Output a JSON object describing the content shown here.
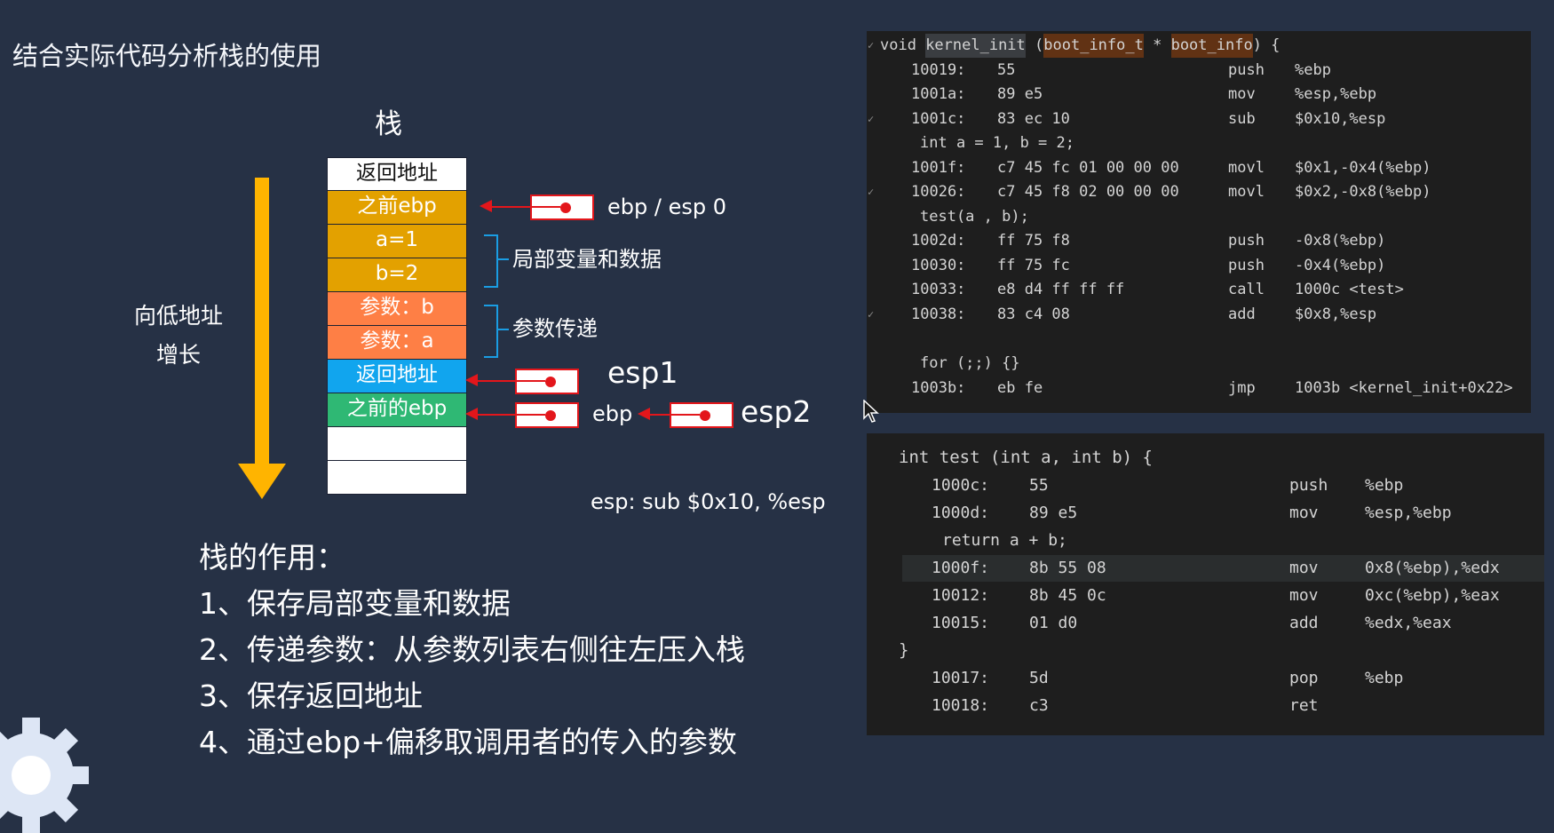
{
  "title": "结合实际代码分析栈的使用",
  "stack": {
    "heading": "栈",
    "cells": [
      {
        "text": "返回地址",
        "color": "#ffffff"
      },
      {
        "text": "之前ebp",
        "color": "#e3a100"
      },
      {
        "text": "a=1",
        "color": "#e3a100"
      },
      {
        "text": "b=2",
        "color": "#e3a100"
      },
      {
        "text": "参数：b",
        "color": "#fe7f45"
      },
      {
        "text": "参数：a",
        "color": "#fe7f45"
      },
      {
        "text": "返回地址",
        "color": "#11a5ee"
      },
      {
        "text": "之前的ebp",
        "color": "#2fb874"
      },
      {
        "text": "",
        "color": "#ffffff"
      },
      {
        "text": "",
        "color": "#ffffff"
      }
    ]
  },
  "direction_label": {
    "line1": "向低地址",
    "line2": "增长"
  },
  "annotations": {
    "ebp_esp0": "ebp / esp 0",
    "locals": "局部变量和数据",
    "params": "参数传递",
    "esp1": "esp1",
    "ebp": "ebp",
    "esp2": "esp2",
    "sub_note": "esp: sub $0x10, %esp"
  },
  "usage": {
    "heading": "栈的作用：",
    "items": [
      "1、保存局部变量和数据",
      "2、传递参数：从参数列表右侧往左压入栈",
      "3、保存返回地址",
      "4、通过ebp+偏移取调用者的传入的参数"
    ]
  },
  "code_top": {
    "header": {
      "prefix": "void ",
      "name": "kernel_init",
      "mid": " (",
      "type": "boot_info_t",
      "star": " * ",
      "param": "boot_info",
      "suffix": ") {"
    },
    "lines": [
      {
        "addr": "10019:",
        "bytes": "55",
        "op": "push",
        "args": "%ebp"
      },
      {
        "addr": "1001a:",
        "bytes": "89 e5",
        "op": "mov",
        "args": "%esp,%ebp"
      },
      {
        "addr": "1001c:",
        "bytes": "83 ec 10",
        "op": "sub",
        "args": "$0x10,%esp"
      },
      {
        "src": "int a = 1, b = 2;"
      },
      {
        "addr": "1001f:",
        "bytes": "c7 45 fc 01 00 00 00",
        "op": "movl",
        "args": "$0x1,-0x4(%ebp)"
      },
      {
        "addr": "10026:",
        "bytes": "c7 45 f8 02 00 00 00",
        "op": "movl",
        "args": "$0x2,-0x8(%ebp)"
      },
      {
        "src": "test(a , b);"
      },
      {
        "addr": "1002d:",
        "bytes": "ff 75 f8",
        "op": "push",
        "args": "-0x8(%ebp)"
      },
      {
        "addr": "10030:",
        "bytes": "ff 75 fc",
        "op": "push",
        "args": "-0x4(%ebp)"
      },
      {
        "addr": "10033:",
        "bytes": "e8 d4 ff ff ff",
        "op": "call",
        "args": "1000c <test>"
      },
      {
        "addr": "10038:",
        "bytes": "83 c4 08",
        "op": "add",
        "args": "$0x8,%esp"
      },
      {
        "blank": ""
      },
      {
        "src": "for (;;) {}"
      },
      {
        "addr": "1003b:",
        "bytes": "eb fe",
        "op": "jmp",
        "args": "1003b <kernel_init+0x22>"
      }
    ]
  },
  "code_bottom": {
    "header": "int test (int a, int b) {",
    "lines": [
      {
        "addr": "1000c:",
        "bytes": "55",
        "op": "push",
        "args": "%ebp"
      },
      {
        "addr": "1000d:",
        "bytes": "89 e5",
        "op": "mov",
        "args": "%esp,%ebp"
      },
      {
        "src": "return a + b;"
      },
      {
        "addr": "1000f:",
        "bytes": "8b 55 08",
        "op": "mov",
        "args": "0x8(%ebp),%edx"
      },
      {
        "addr": "10012:",
        "bytes": "8b 45 0c",
        "op": "mov",
        "args": "0xc(%ebp),%eax"
      },
      {
        "addr": "10015:",
        "bytes": "01 d0",
        "op": "add",
        "args": "%edx,%eax"
      },
      {
        "src": "}"
      },
      {
        "addr": "10017:",
        "bytes": "5d",
        "op": "pop",
        "args": "%ebp"
      },
      {
        "addr": "10018:",
        "bytes": "c3",
        "op": "ret",
        "args": ""
      }
    ]
  },
  "colors": {
    "background": "#263145",
    "arrow": "#ffb400",
    "pointer": "#e3161b",
    "brace": "#1a9de3"
  }
}
